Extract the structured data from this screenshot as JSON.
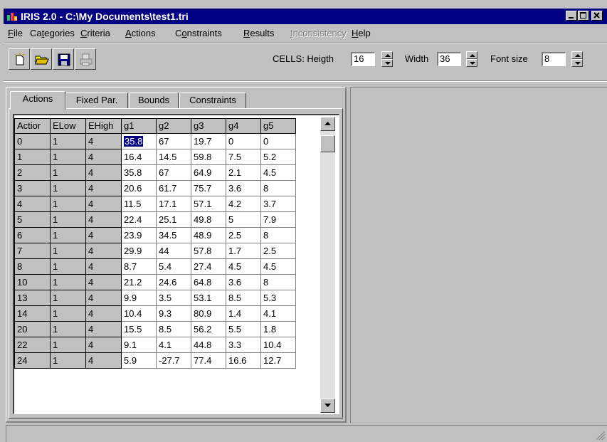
{
  "window": {
    "title": "IRIS 2.0  -  C:\\My Documents\\test1.tri"
  },
  "menu": [
    {
      "pre": "",
      "u": "F",
      "post": "ile",
      "disabled": false
    },
    {
      "pre": "Ca",
      "u": "t",
      "post": "egories",
      "disabled": false
    },
    {
      "pre": "",
      "u": "C",
      "post": "riteria",
      "disabled": false
    },
    {
      "pre": "",
      "u": "A",
      "post": "ctions",
      "disabled": false
    },
    {
      "pre": "C",
      "u": "o",
      "post": "nstraints",
      "disabled": false
    },
    {
      "pre": "",
      "u": "R",
      "post": "esults",
      "disabled": false
    },
    {
      "pre": "",
      "u": "I",
      "post": "nconsistency",
      "disabled": true
    },
    {
      "pre": "",
      "u": "H",
      "post": "elp",
      "disabled": false
    }
  ],
  "toolbar": {
    "buttons": [
      "new-icon",
      "open-folder-icon",
      "save-disk-icon",
      "print-icon"
    ],
    "cells_label": "CELLS: Heigth",
    "height_value": "16",
    "width_label": "Width",
    "width_value": "36",
    "font_label": "Font size",
    "font_value": "8"
  },
  "tabs": [
    "Actions",
    "Fixed Par.",
    "Bounds",
    "Constraints"
  ],
  "grid": {
    "headers": [
      "Actior",
      "ELow",
      "EHigh",
      "g1",
      "g2",
      "g3",
      "g4",
      "g5"
    ],
    "rows": [
      [
        "0",
        "1",
        "4",
        "35.8",
        "67",
        "19.7",
        "0",
        "0"
      ],
      [
        "1",
        "1",
        "4",
        "16.4",
        "14.5",
        "59.8",
        "7.5",
        "5.2"
      ],
      [
        "2",
        "1",
        "4",
        "35.8",
        "67",
        "64.9",
        "2.1",
        "4.5"
      ],
      [
        "3",
        "1",
        "4",
        "20.6",
        "61.7",
        "75.7",
        "3.6",
        "8"
      ],
      [
        "4",
        "1",
        "4",
        "11.5",
        "17.1",
        "57.1",
        "4.2",
        "3.7"
      ],
      [
        "5",
        "1",
        "4",
        "22.4",
        "25.1",
        "49.8",
        "5",
        "7.9"
      ],
      [
        "6",
        "1",
        "4",
        "23.9",
        "34.5",
        "48.9",
        "2.5",
        "8"
      ],
      [
        "7",
        "1",
        "4",
        "29.9",
        "44",
        "57.8",
        "1.7",
        "2.5"
      ],
      [
        "8",
        "1",
        "4",
        "8.7",
        "5.4",
        "27.4",
        "4.5",
        "4.5"
      ],
      [
        "10",
        "1",
        "4",
        "21.2",
        "24.6",
        "64.8",
        "3.6",
        "8"
      ],
      [
        "13",
        "1",
        "4",
        "9.9",
        "3.5",
        "53.1",
        "8.5",
        "5.3"
      ],
      [
        "14",
        "1",
        "4",
        "10.4",
        "9.3",
        "80.9",
        "1.4",
        "4.1"
      ],
      [
        "20",
        "1",
        "4",
        "15.5",
        "8.5",
        "56.2",
        "5.5",
        "1.8"
      ],
      [
        "22",
        "1",
        "4",
        "9.1",
        "4.1",
        "44.8",
        "3.3",
        "10.4"
      ],
      [
        "24",
        "1",
        "4",
        "5.9",
        "-27.7",
        "77.4",
        "16.6",
        "12.7"
      ]
    ]
  },
  "colors": {
    "titlebar": "#000080",
    "face": "#c0c0c0",
    "selection": "#000080"
  }
}
